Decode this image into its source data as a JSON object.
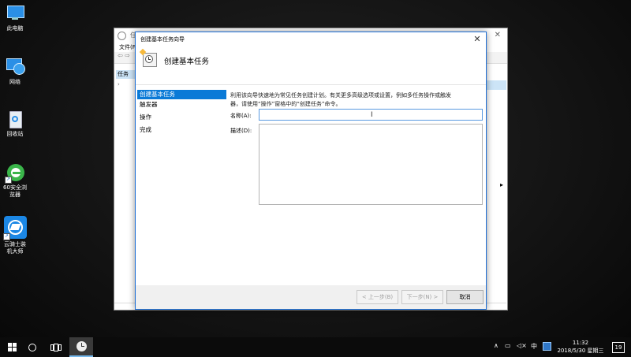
{
  "desktop": {
    "icons": [
      {
        "label": "此电脑"
      },
      {
        "label": "网络"
      },
      {
        "label": "回收站"
      },
      {
        "label": "60安全浏览器"
      },
      {
        "label": "云骑士装机大师"
      }
    ]
  },
  "background_window": {
    "title": "任",
    "menu_file": "文件(F",
    "tree_item": "任务"
  },
  "dialog": {
    "title": "创建基本任务向导",
    "heading": "创建基本任务",
    "steps": [
      "创建基本任务",
      "触发器",
      "操作",
      "完成"
    ],
    "description_line1": "利用该向导快速地为常见任务创建计划。有关更多高级选项或设置，例如多任务操作或触发",
    "description_line2": "器，请使用“操作”窗格中的“创建任务”命令。",
    "name_label": "名称(A):",
    "name_value": "",
    "desc_label": "描述(D):",
    "desc_value": "",
    "buttons": {
      "back": "< 上一步(B)",
      "next": "下一步(N) >",
      "cancel": "取消"
    }
  },
  "taskbar": {
    "ime": "中",
    "time": "11:32",
    "date": "2018/5/30 星期三",
    "notification_count": "19"
  },
  "colors": {
    "accent": "#0a7ad7",
    "taskbar": "#0b0b0b"
  }
}
